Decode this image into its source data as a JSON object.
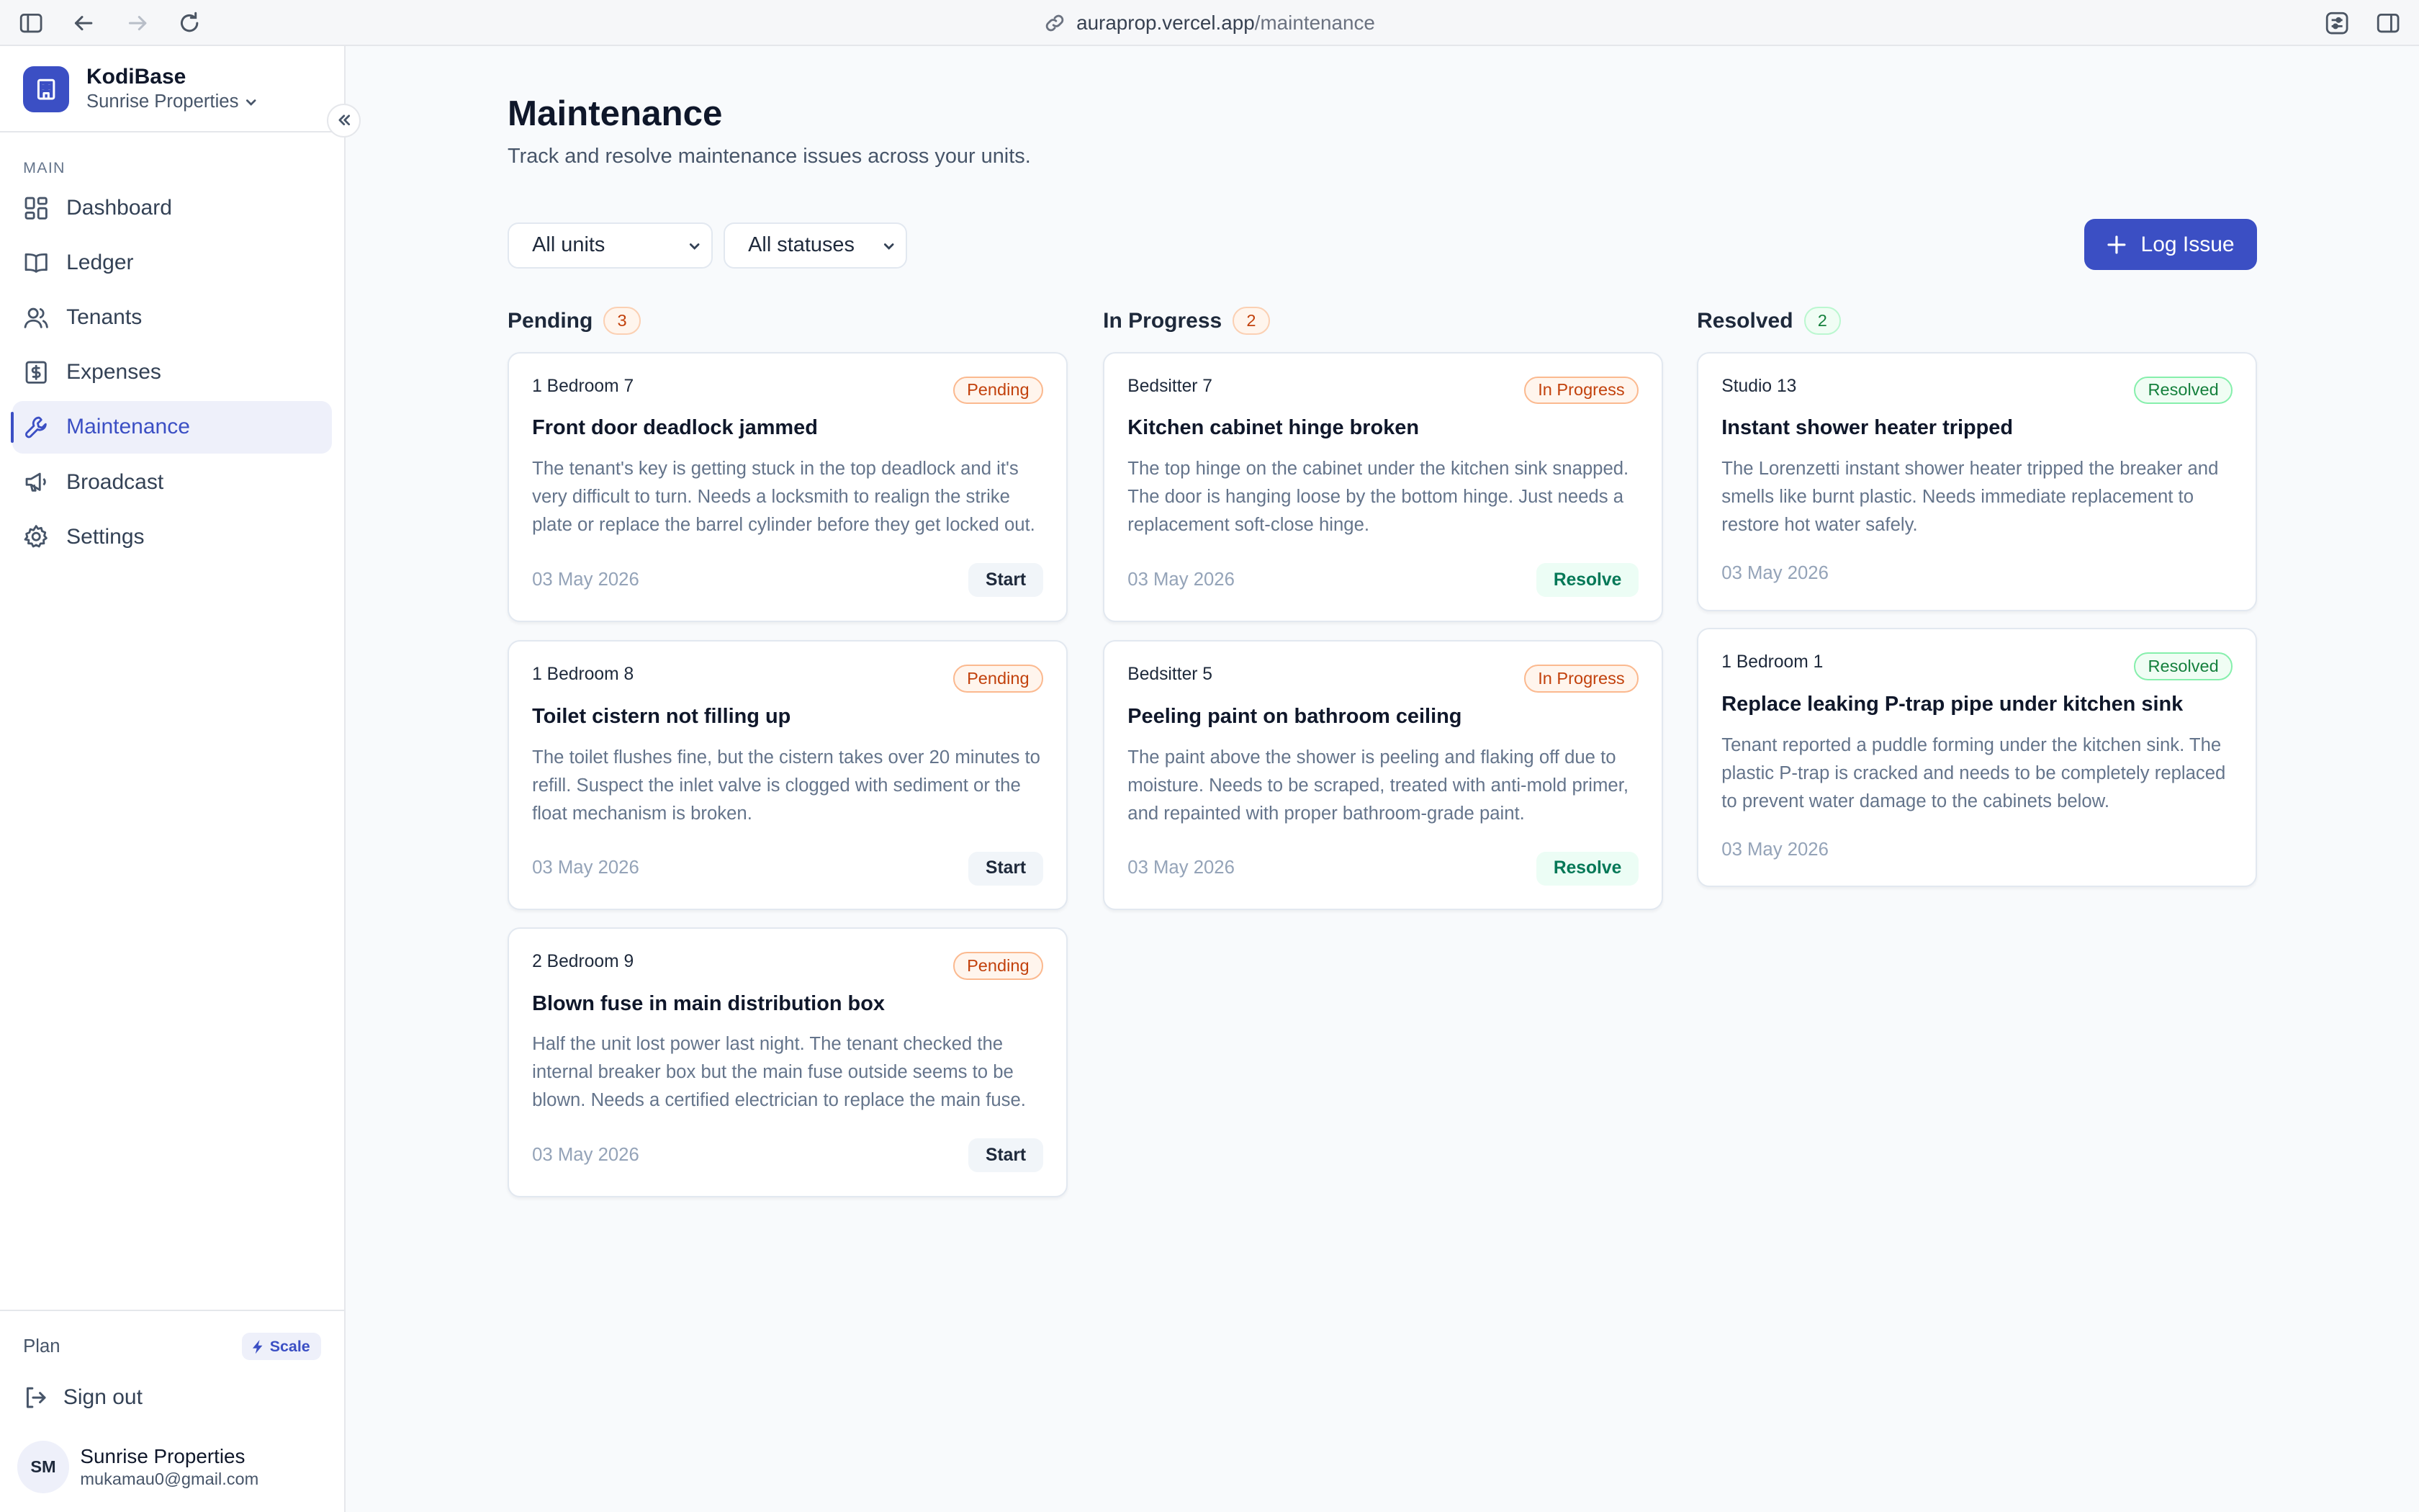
{
  "browser": {
    "url_host": "auraprop.vercel.app",
    "url_path": "/maintenance"
  },
  "sidebar": {
    "brand_name": "KodiBase",
    "org_name": "Sunrise Properties",
    "section_label": "MAIN",
    "items": [
      {
        "label": "Dashboard",
        "icon": "dashboard-icon"
      },
      {
        "label": "Ledger",
        "icon": "book-icon"
      },
      {
        "label": "Tenants",
        "icon": "users-icon"
      },
      {
        "label": "Expenses",
        "icon": "receipt-icon"
      },
      {
        "label": "Maintenance",
        "icon": "wrench-icon",
        "active": true
      },
      {
        "label": "Broadcast",
        "icon": "megaphone-icon"
      },
      {
        "label": "Settings",
        "icon": "gear-icon"
      }
    ],
    "plan_label": "Plan",
    "plan_badge": "Scale",
    "sign_out": "Sign out",
    "user_initials": "SM",
    "user_name": "Sunrise Properties",
    "user_email": "mukamau0@gmail.com"
  },
  "page": {
    "title": "Maintenance",
    "subtitle": "Track and resolve maintenance issues across your units.",
    "filters": {
      "unit": "All units",
      "status": "All statuses"
    },
    "log_button": "Log Issue"
  },
  "columns": [
    {
      "name": "Pending",
      "count": "3",
      "cards": [
        {
          "unit": "1 Bedroom 7",
          "status": "Pending",
          "title": "Front door deadlock jammed",
          "description": "The tenant's key is getting stuck in the top deadlock and it's very difficult to turn. Needs a locksmith to realign the strike plate or replace the barrel cylinder before they get locked out.",
          "date": "03 May 2026",
          "action": "Start"
        },
        {
          "unit": "1 Bedroom 8",
          "status": "Pending",
          "title": "Toilet cistern not filling up",
          "description": "The toilet flushes fine, but the cistern takes over 20 minutes to refill. Suspect the inlet valve is clogged with sediment or the float mechanism is broken.",
          "date": "03 May 2026",
          "action": "Start"
        },
        {
          "unit": "2 Bedroom 9",
          "status": "Pending",
          "title": "Blown fuse in main distribution box",
          "description": "Half the unit lost power last night. The tenant checked the internal breaker box but the main fuse outside seems to be blown. Needs a certified electrician to replace the main fuse.",
          "date": "03 May 2026",
          "action": "Start"
        }
      ]
    },
    {
      "name": "In Progress",
      "count": "2",
      "cards": [
        {
          "unit": "Bedsitter 7",
          "status": "In Progress",
          "title": "Kitchen cabinet hinge broken",
          "description": "The top hinge on the cabinet under the kitchen sink snapped. The door is hanging loose by the bottom hinge. Just needs a replacement soft-close hinge.",
          "date": "03 May 2026",
          "action": "Resolve"
        },
        {
          "unit": "Bedsitter 5",
          "status": "In Progress",
          "title": "Peeling paint on bathroom ceiling",
          "description": "The paint above the shower is peeling and flaking off due to moisture. Needs to be scraped, treated with anti-mold primer, and repainted with proper bathroom-grade paint.",
          "date": "03 May 2026",
          "action": "Resolve"
        }
      ]
    },
    {
      "name": "Resolved",
      "count": "2",
      "cards": [
        {
          "unit": "Studio 13",
          "status": "Resolved",
          "title": "Instant shower heater tripped",
          "description": "The Lorenzetti instant shower heater tripped the breaker and smells like burnt plastic. Needs immediate replacement to restore hot water safely.",
          "date": "03 May 2026"
        },
        {
          "unit": "1 Bedroom 1",
          "status": "Resolved",
          "title": "Replace leaking P-trap pipe under kitchen sink",
          "description": "Tenant reported a puddle forming under the kitchen sink. The plastic P-trap is cracked and needs to be completely replaced to prevent water damage to the cabinets below.",
          "date": "03 May 2026"
        }
      ]
    }
  ],
  "colors": {
    "accent": "#3b4fc4",
    "pending": "#c2410c",
    "resolved": "#15803d"
  }
}
